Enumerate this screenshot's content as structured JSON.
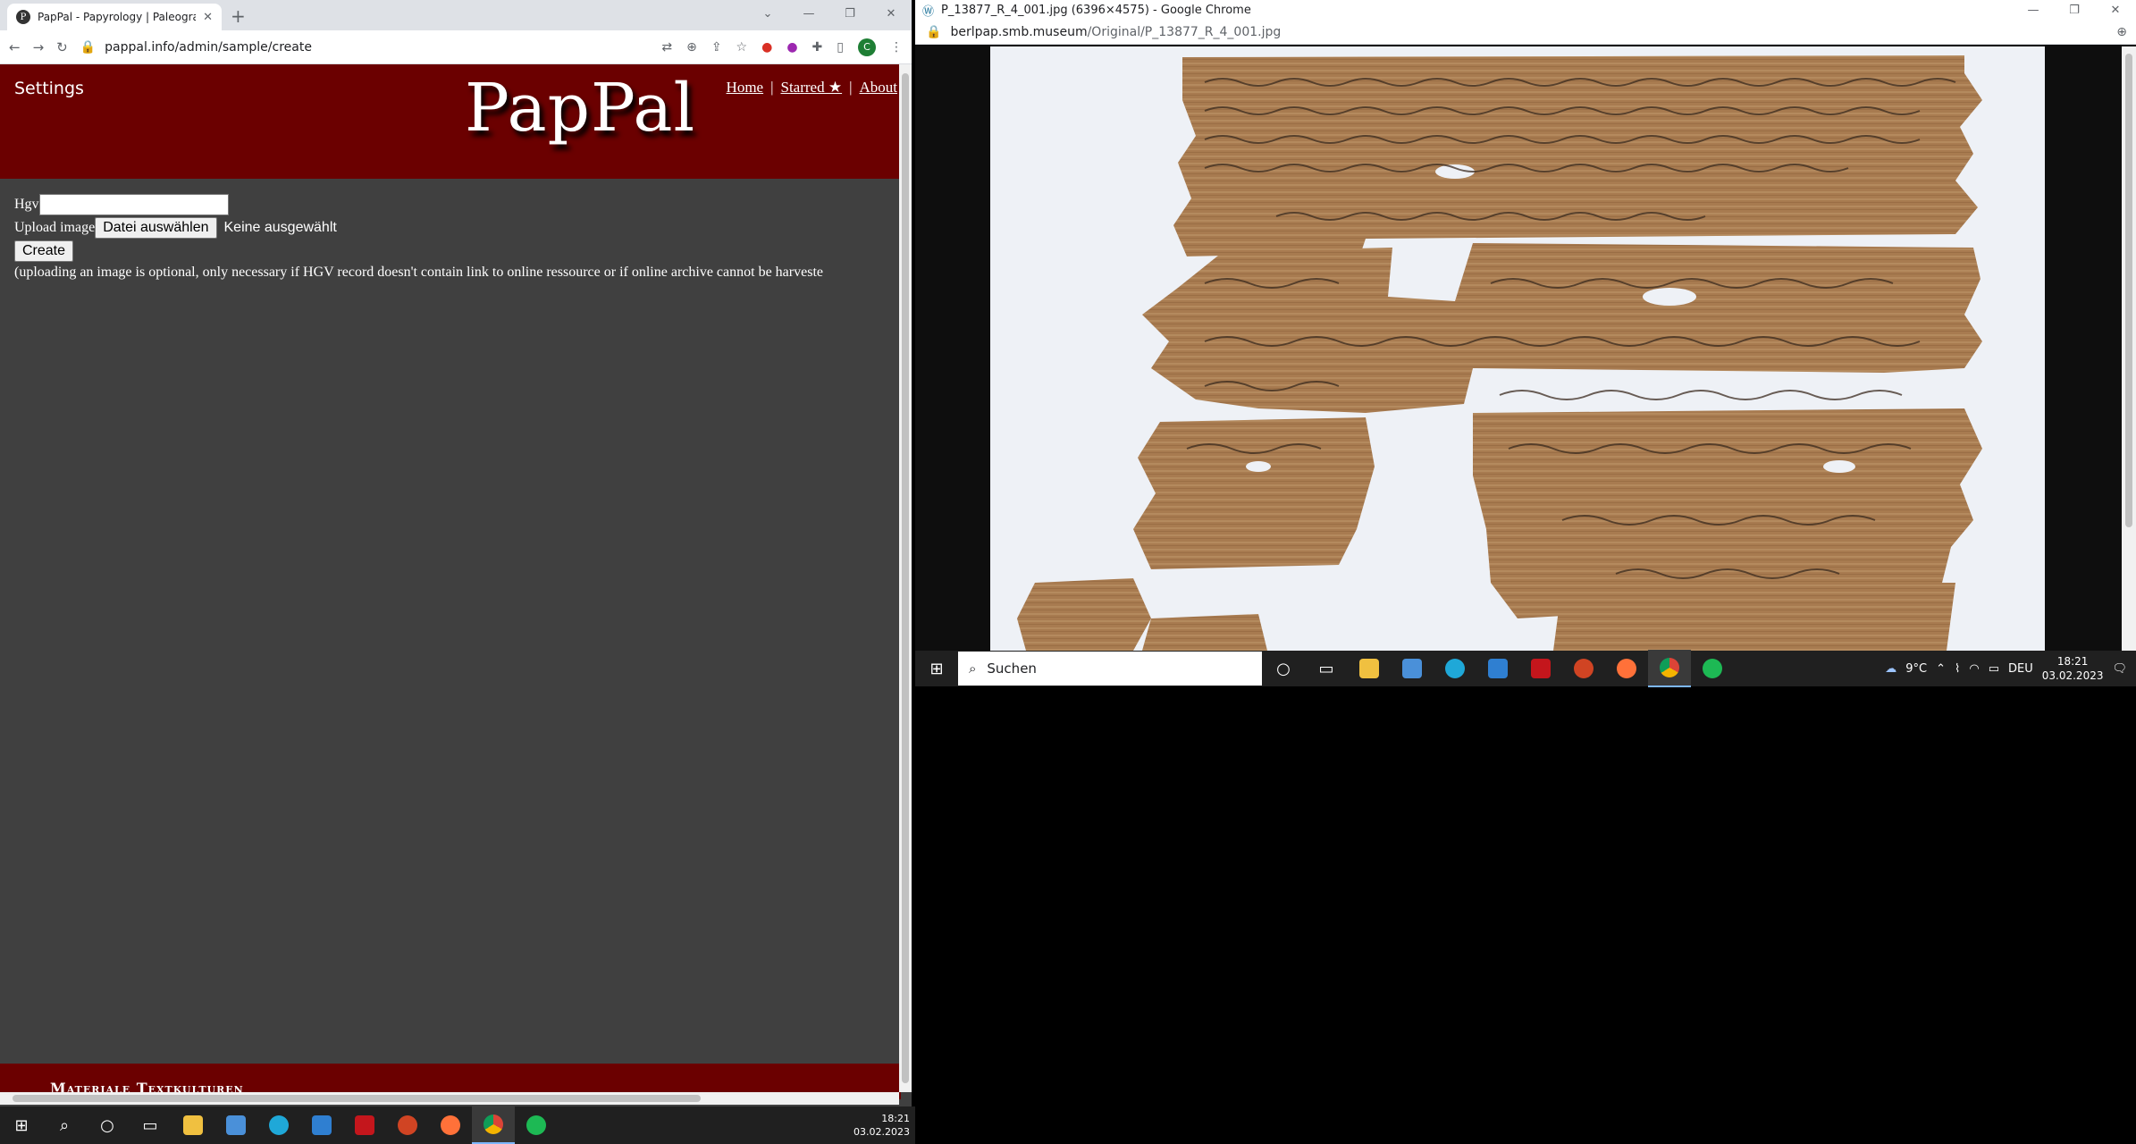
{
  "left_browser": {
    "tab_title": "PapPal - Papyrology | Paleograph",
    "url": "pappal.info/admin/sample/create"
  },
  "site": {
    "settings_label": "Settings",
    "logo_text": "PapPal",
    "nav": [
      {
        "label": "Home"
      },
      {
        "label": "Starred ★"
      },
      {
        "label": "About"
      }
    ],
    "nav_sep": "|",
    "form": {
      "hgv_label": "Hgv",
      "hgv_value": "",
      "upload_label": "Upload image",
      "choose_file_label": "Datei auswählen",
      "file_status": "Keine ausgewählt",
      "create_label": "Create",
      "hint": "(uploading an image is optional, only necessary if HGV record doesn't contain link to online ressource or if online archive cannot be harveste"
    },
    "footer_text": "Materiale Textkulturen"
  },
  "right_browser": {
    "title": "P_13877_R_4_001.jpg (6396×4575) - Google Chrome",
    "url_host": "berlpap.smb.museum",
    "url_path": "/Original/P_13877_R_4_001.jpg"
  },
  "taskbar_left": {
    "time": "18:21",
    "date": "03.02.2023"
  },
  "taskbar_right": {
    "search_placeholder": "Suchen",
    "weather": "9°C",
    "language": "DEU",
    "time": "18:21",
    "date": "03.02.2023"
  },
  "colors": {
    "brand_red": "#6b0000",
    "page_bg": "#404040"
  }
}
